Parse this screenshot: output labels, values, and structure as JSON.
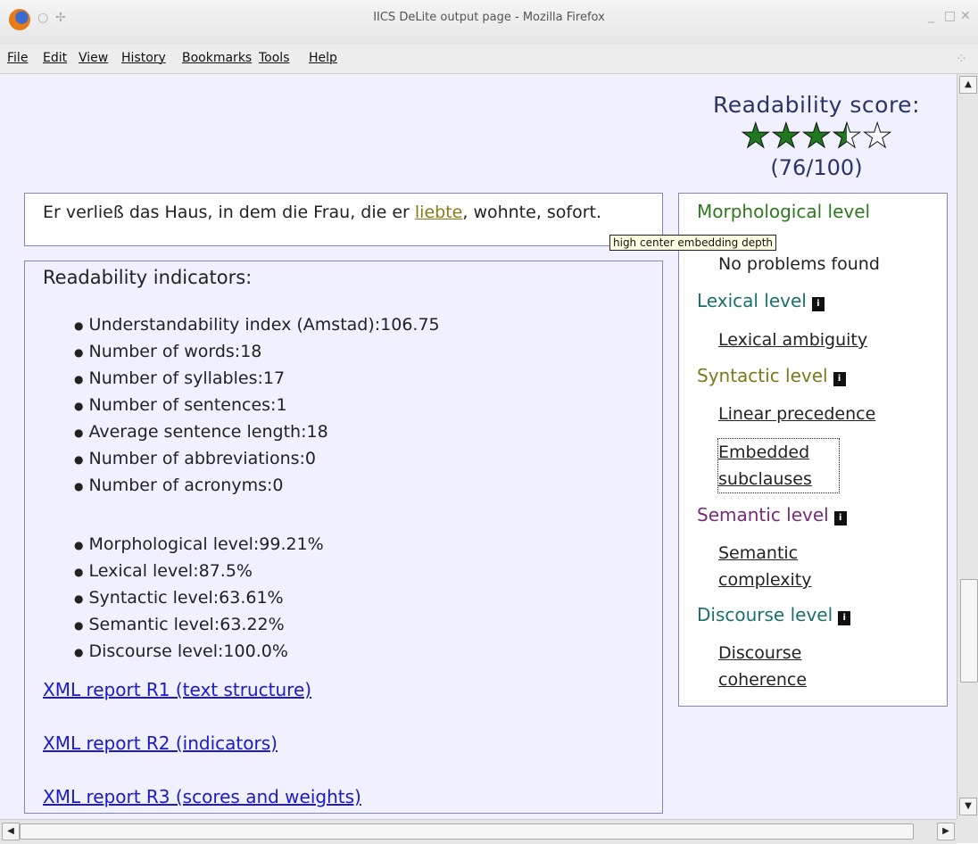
{
  "window": {
    "title": "IICS DeLite output page - Mozilla Firefox"
  },
  "menu": [
    "File",
    "Edit",
    "View",
    "History",
    "Bookmarks",
    "Tools",
    "Help"
  ],
  "score": {
    "label": "Readability score:",
    "value": "(76/100)",
    "stars": 3.5,
    "max_stars": 5,
    "star_color": "#1f7a1f"
  },
  "sentence": {
    "part1": "Er verließ das Haus, in dem die Frau, die er ",
    "link": "liebte",
    "part2": ", wohnte, sofort."
  },
  "tooltip": "high center embedding depth",
  "indicators": {
    "title": "Readability indicators:",
    "basic": [
      "Understandability index (Amstad):106.75",
      "Number of words:18",
      "Number of syllables:17",
      "Number of sentences:1",
      "Average sentence length:18",
      "Number of abbreviations:0",
      "Number of acronyms:0"
    ],
    "levels": [
      "Morphological level:99.21%",
      "Lexical level:87.5%",
      "Syntactic level:63.61%",
      "Semantic level:63.22%",
      "Discourse level:100.0%"
    ]
  },
  "reports": [
    "XML report R1 (text structure)",
    "XML report R2 (indicators)",
    "XML report R3 (scores and weights)"
  ],
  "levels_panel": [
    {
      "title": "Morphological level",
      "color": "#2d7a1e",
      "items": [
        "No problems found"
      ]
    },
    {
      "title": "Lexical level",
      "color": "#1a7070",
      "items": [
        "Lexical ambiguity"
      ]
    },
    {
      "title": "Syntactic level",
      "color": "#7a7a1a",
      "items": [
        "Linear precedence",
        "Embedded subclauses"
      ]
    },
    {
      "title": "Semantic level",
      "color": "#7a2a7a",
      "items": [
        "Semantic complexity"
      ]
    },
    {
      "title": "Discourse level",
      "color": "#1a7070",
      "items": [
        "Discourse coherence"
      ]
    }
  ],
  "icons": {
    "info": "i",
    "scroll_up": "▲",
    "scroll_down": "▼",
    "scroll_left": "◀",
    "scroll_right": "▶"
  }
}
